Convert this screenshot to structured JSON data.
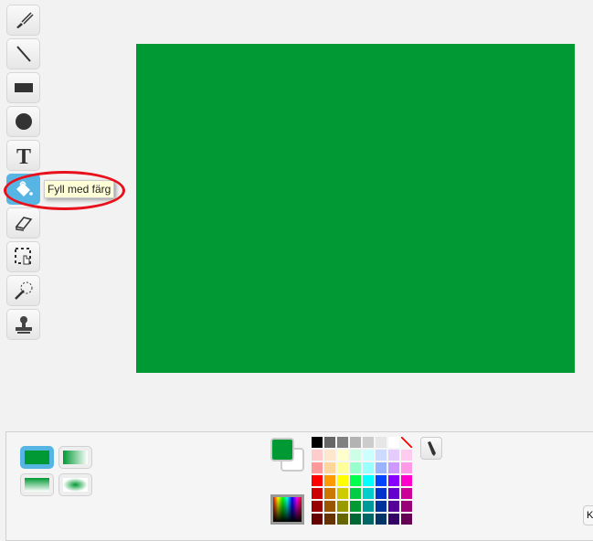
{
  "tools": [
    {
      "name": "brush",
      "icon": "paintbrush-icon"
    },
    {
      "name": "line",
      "icon": "line-icon"
    },
    {
      "name": "rectangle",
      "icon": "rectangle-icon"
    },
    {
      "name": "ellipse",
      "icon": "ellipse-icon"
    },
    {
      "name": "text",
      "icon": "text-icon"
    },
    {
      "name": "fill",
      "icon": "paint-bucket-icon",
      "selected": true
    },
    {
      "name": "eraser",
      "icon": "eraser-icon"
    },
    {
      "name": "select",
      "icon": "select-icon"
    },
    {
      "name": "reshape",
      "icon": "magic-wand-icon"
    },
    {
      "name": "stamp",
      "icon": "stamp-icon"
    }
  ],
  "tooltip": "Fyll med färg",
  "canvas_color": "#009933",
  "primary_color": "#009933",
  "secondary_color": "#ffffff",
  "palette": [
    [
      "#000000",
      "#666666",
      "#808080",
      "#b3b3b3",
      "#cccccc",
      "#e6e6e6",
      "#ffffff",
      "transparent"
    ],
    [
      "#ffcccc",
      "#ffe6cc",
      "#ffffcc",
      "#ccffe6",
      "#ccffff",
      "#ccdaff",
      "#e5ccff",
      "#ffccf0"
    ],
    [
      "#ff9999",
      "#ffd699",
      "#ffff99",
      "#99ffcc",
      "#99ffff",
      "#99b3ff",
      "#cc99ff",
      "#ff99e6"
    ],
    [
      "#ff0000",
      "#ff9900",
      "#ffff00",
      "#00ff4c",
      "#00ffff",
      "#0044ff",
      "#8800ff",
      "#ff00cc"
    ],
    [
      "#cc0000",
      "#cc7700",
      "#cccc00",
      "#00cc44",
      "#00cccc",
      "#0033cc",
      "#6600cc",
      "#cc0099"
    ],
    [
      "#990000",
      "#995500",
      "#999900",
      "#009933",
      "#009999",
      "#003399",
      "#550099",
      "#990077"
    ],
    [
      "#660000",
      "#663300",
      "#666600",
      "#006633",
      "#006666",
      "#003366",
      "#330066",
      "#660055"
    ]
  ],
  "bottom_button_label": "K"
}
